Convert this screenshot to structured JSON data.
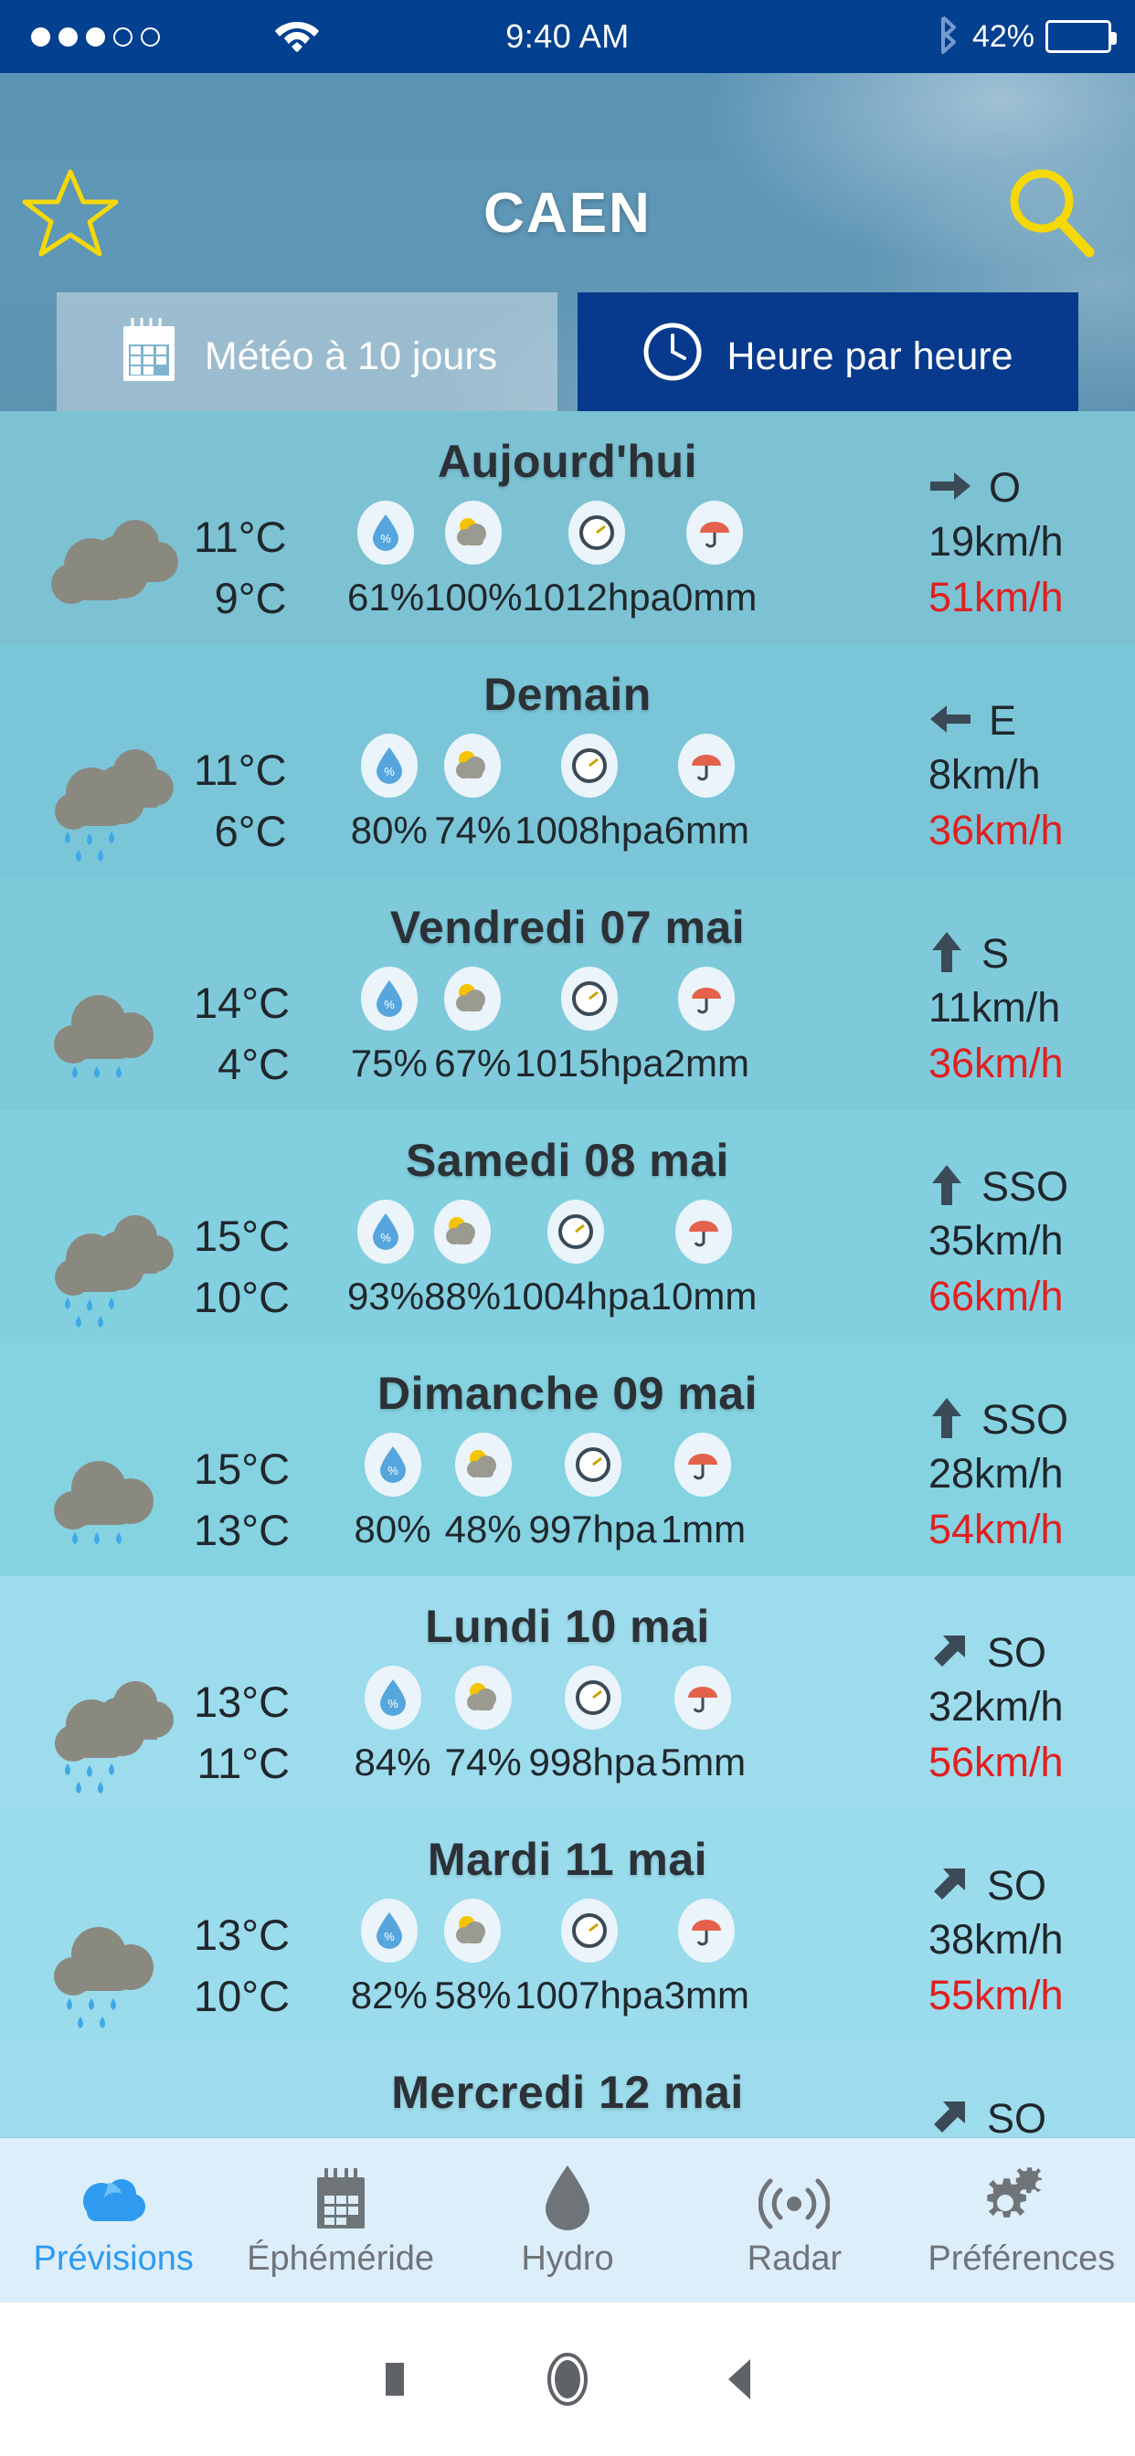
{
  "statusbar": {
    "signal_dots_filled": 3,
    "signal_dots_total": 5,
    "wifi_icon": "wifi-icon",
    "time": "9:40 AM",
    "bluetooth_icon": "bluetooth-icon",
    "battery_percent": "42%",
    "battery_level": 42
  },
  "header": {
    "title": "CAEN",
    "favorite_icon": "star-outline-icon",
    "search_icon": "magnifier-icon",
    "accent_yellow": "#f5d808",
    "bg_color": "#5f97b6"
  },
  "tabs": [
    {
      "label": "Météo à 10 jours",
      "icon": "calendar-icon",
      "active": false
    },
    {
      "label": "Heure par heure",
      "icon": "clock-icon",
      "active": true
    }
  ],
  "colors": {
    "tab_active_bg": "#073a8c",
    "status_bg": "#03408f",
    "gust_red": "#e02020",
    "nav_active": "#2e9bf0",
    "nav_bg": "#ddeefb"
  },
  "forecast": {
    "units": {
      "temp": "°C",
      "humidity": "%",
      "cloud": "%",
      "pressure": "hpa",
      "rain": "mm",
      "wind": "km/h"
    },
    "rows": [
      {
        "day": "Aujourd'hui",
        "icon": "cloudy-icon",
        "temp_high": "11°C",
        "temp_low": "9°C",
        "humidity": "61%",
        "cloud_cover": "100%",
        "pressure": "1012hpa",
        "rain": "0mm",
        "wind_dir": "O",
        "wind_arrow": "right",
        "wind_speed": "19km/h",
        "wind_gust": "51km/h"
      },
      {
        "day": "Demain",
        "icon": "rain-icon",
        "temp_high": "11°C",
        "temp_low": "6°C",
        "humidity": "80%",
        "cloud_cover": "74%",
        "pressure": "1008hpa",
        "rain": "6mm",
        "wind_dir": "E",
        "wind_arrow": "left",
        "wind_speed": "8km/h",
        "wind_gust": "36km/h"
      },
      {
        "day": "Vendredi 07 mai",
        "icon": "rain-single-icon",
        "temp_high": "14°C",
        "temp_low": "4°C",
        "humidity": "75%",
        "cloud_cover": "67%",
        "pressure": "1015hpa",
        "rain": "2mm",
        "wind_dir": "S",
        "wind_arrow": "up",
        "wind_speed": "11km/h",
        "wind_gust": "36km/h"
      },
      {
        "day": "Samedi 08 mai",
        "icon": "rain-icon",
        "temp_high": "15°C",
        "temp_low": "10°C",
        "humidity": "93%",
        "cloud_cover": "88%",
        "pressure": "1004hpa",
        "rain": "10mm",
        "wind_dir": "SSO",
        "wind_arrow": "up",
        "wind_speed": "35km/h",
        "wind_gust": "66km/h"
      },
      {
        "day": "Dimanche 09 mai",
        "icon": "rain-single-icon",
        "temp_high": "15°C",
        "temp_low": "13°C",
        "humidity": "80%",
        "cloud_cover": "48%",
        "pressure": "997hpa",
        "rain": "1mm",
        "wind_dir": "SSO",
        "wind_arrow": "up",
        "wind_speed": "28km/h",
        "wind_gust": "54km/h"
      },
      {
        "day": "Lundi 10 mai",
        "icon": "rain-icon",
        "temp_high": "13°C",
        "temp_low": "11°C",
        "humidity": "84%",
        "cloud_cover": "74%",
        "pressure": "998hpa",
        "rain": "5mm",
        "wind_dir": "SO",
        "wind_arrow": "upright",
        "wind_speed": "32km/h",
        "wind_gust": "56km/h"
      },
      {
        "day": "Mardi 11 mai",
        "icon": "rain-single-icon",
        "temp_high": "13°C",
        "temp_low": "10°C",
        "humidity": "82%",
        "cloud_cover": "58%",
        "pressure": "1007hpa",
        "rain": "3mm",
        "wind_dir": "SO",
        "wind_arrow": "upright",
        "wind_speed": "38km/h",
        "wind_gust": "55km/h"
      },
      {
        "day": "Mercredi 12 mai",
        "icon": "rain-single-icon",
        "temp_high": "",
        "temp_low": "",
        "humidity": "",
        "cloud_cover": "",
        "pressure": "",
        "rain": "",
        "wind_dir": "SO",
        "wind_arrow": "upright",
        "wind_speed": "",
        "wind_gust": ""
      }
    ]
  },
  "bottomnav": [
    {
      "label": "Prévisions",
      "icon": "cloud-icon",
      "active": true
    },
    {
      "label": "Éphéméride",
      "icon": "calendar-icon",
      "active": false
    },
    {
      "label": "Hydro",
      "icon": "droplet-icon",
      "active": false
    },
    {
      "label": "Radar",
      "icon": "radar-icon",
      "active": false
    },
    {
      "label": "Préférences",
      "icon": "gears-icon",
      "active": false
    }
  ],
  "androidnav": [
    {
      "icon": "recents-square-icon"
    },
    {
      "icon": "home-circle-icon"
    },
    {
      "icon": "back-triangle-icon"
    }
  ]
}
